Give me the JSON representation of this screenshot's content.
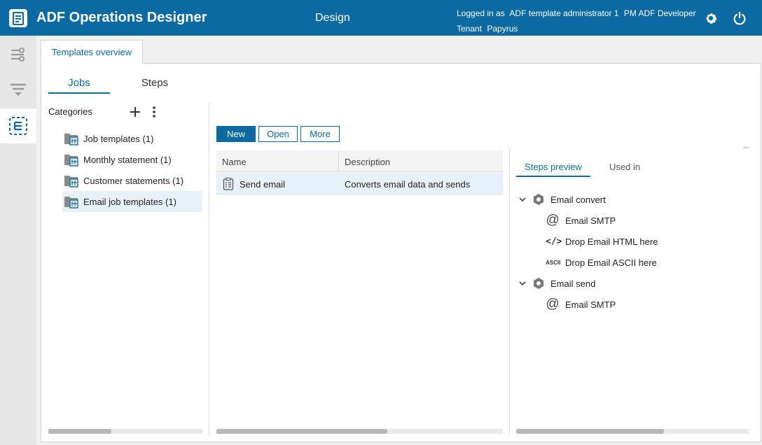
{
  "header": {
    "app_title": "ADF Operations Designer",
    "nav_title": "Design",
    "logged_in_label": "Logged in as",
    "user_name": "ADF template administrator 1",
    "role": "PM ADF Developer",
    "tenant_label": "Tenant",
    "tenant": "Papyrus",
    "accent": "#0a6aa1"
  },
  "doc_tab": {
    "label": "Templates overview"
  },
  "subtabs": {
    "jobs": "Jobs",
    "steps": "Steps"
  },
  "categories": {
    "title": "Categories",
    "items": [
      {
        "label": "Job templates (1)"
      },
      {
        "label": "Monthly statement (1)"
      },
      {
        "label": "Customer statements (1)"
      },
      {
        "label": "Email job templates (1)"
      }
    ]
  },
  "toolbar": {
    "new": "New",
    "open": "Open",
    "more": "More"
  },
  "grid": {
    "columns": [
      "Name",
      "Description"
    ],
    "rows": [
      {
        "name": "Send email",
        "description": "Converts email data and sends"
      }
    ]
  },
  "preview": {
    "tabs": [
      "Steps preview",
      "Used in"
    ],
    "tree": [
      {
        "label": "Email convert",
        "icon": "hexagon-icon"
      },
      {
        "label": "Email SMTP",
        "icon": "at-icon"
      },
      {
        "label": "Drop Email HTML here",
        "icon": "code-icon"
      },
      {
        "label": "Drop Email ASCII here",
        "icon": "ascii-icon",
        "icon_text": "ASCII"
      },
      {
        "label": "Email send",
        "icon": "hexagon-icon"
      },
      {
        "label": "Email SMTP",
        "icon": "at-icon"
      }
    ]
  }
}
